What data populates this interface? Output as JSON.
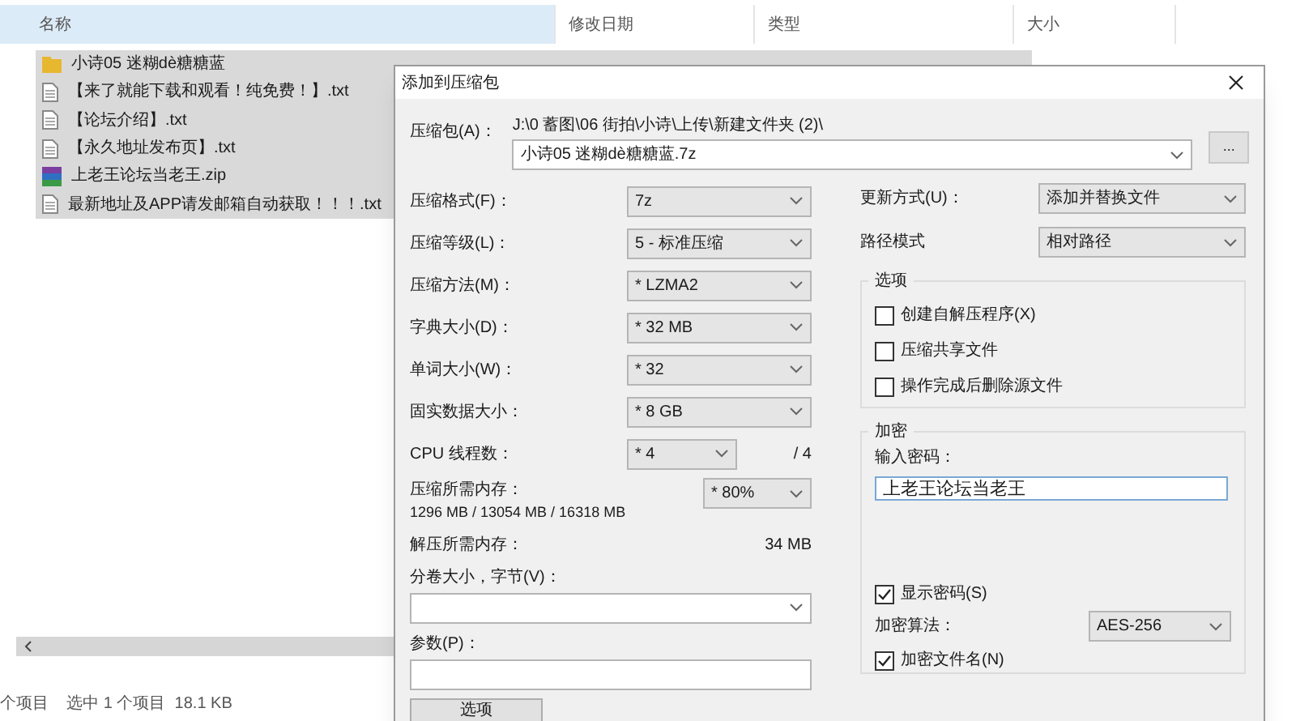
{
  "explorer": {
    "columns": [
      "名称",
      "修改日期",
      "类型",
      "大小"
    ],
    "files": [
      {
        "kind": "folder",
        "name": "小诗05 迷糊dè糖糖蓝",
        "selected": true
      },
      {
        "kind": "text",
        "name": "【来了就能下载和观看！纯免费！】.txt",
        "selected": true
      },
      {
        "kind": "text",
        "name": "【论坛介绍】.txt",
        "selected": true
      },
      {
        "kind": "text",
        "name": "【永久地址发布页】.txt",
        "selected": true
      },
      {
        "kind": "archive",
        "name": "上老王论坛当老王.zip",
        "selected": true
      },
      {
        "kind": "text",
        "name": "最新地址及APP请发邮箱自动获取！！！.txt",
        "selected": true
      }
    ],
    "status_bar": "个项目    选中 1 个项目  18.1 KB"
  },
  "dialog": {
    "title": "添加到压缩包",
    "archive": {
      "label": "压缩包(A)：",
      "path": "J:\\0 蓄图\\06 街拍\\小诗\\上传\\新建文件夹 (2)\\",
      "value": "小诗05 迷糊dè糖糖蓝.7z",
      "browse": "..."
    },
    "settings": [
      {
        "label": "压缩格式(F)：",
        "value": "7z"
      },
      {
        "label": "压缩等级(L)：",
        "value": "5 - 标准压缩"
      },
      {
        "label": "压缩方法(M)：",
        "value": "* LZMA2"
      },
      {
        "label": "字典大小(D)：",
        "value": "* 32 MB"
      },
      {
        "label": "单词大小(W)：",
        "value": "* 32"
      },
      {
        "label": "固实数据大小：",
        "value": "* 8 GB"
      }
    ],
    "threads": {
      "label": "CPU 线程数：",
      "value": "* 4",
      "max": "/ 4"
    },
    "memory": {
      "label": "压缩所需内存：",
      "detail": "1296 MB / 13054 MB / 16318 MB",
      "value": "* 80%"
    },
    "decompress": {
      "label": "解压所需内存：",
      "value": "34 MB"
    },
    "volume": {
      "label": "分卷大小，字节(V)："
    },
    "params": {
      "label": "参数(P)："
    },
    "options_button": "选项",
    "update": {
      "label": "更新方式(U)：",
      "value": "添加并替换文件"
    },
    "path_mode": {
      "label": "路径模式",
      "value": "相对路径"
    },
    "options": {
      "title": "选项",
      "items": [
        {
          "label": "创建自解压程序(X)",
          "checked": false
        },
        {
          "label": "压缩共享文件",
          "checked": false
        },
        {
          "label": "操作完成后删除源文件",
          "checked": false
        }
      ]
    },
    "encryption": {
      "title": "加密",
      "password_label": "输入密码：",
      "password": "上老王论坛当老王",
      "show_password": {
        "label": "显示密码(S)",
        "checked": true
      },
      "method_label": "加密算法：",
      "method": "AES-256",
      "encrypt_names": {
        "label": "加密文件名(N)",
        "checked": true
      }
    }
  }
}
